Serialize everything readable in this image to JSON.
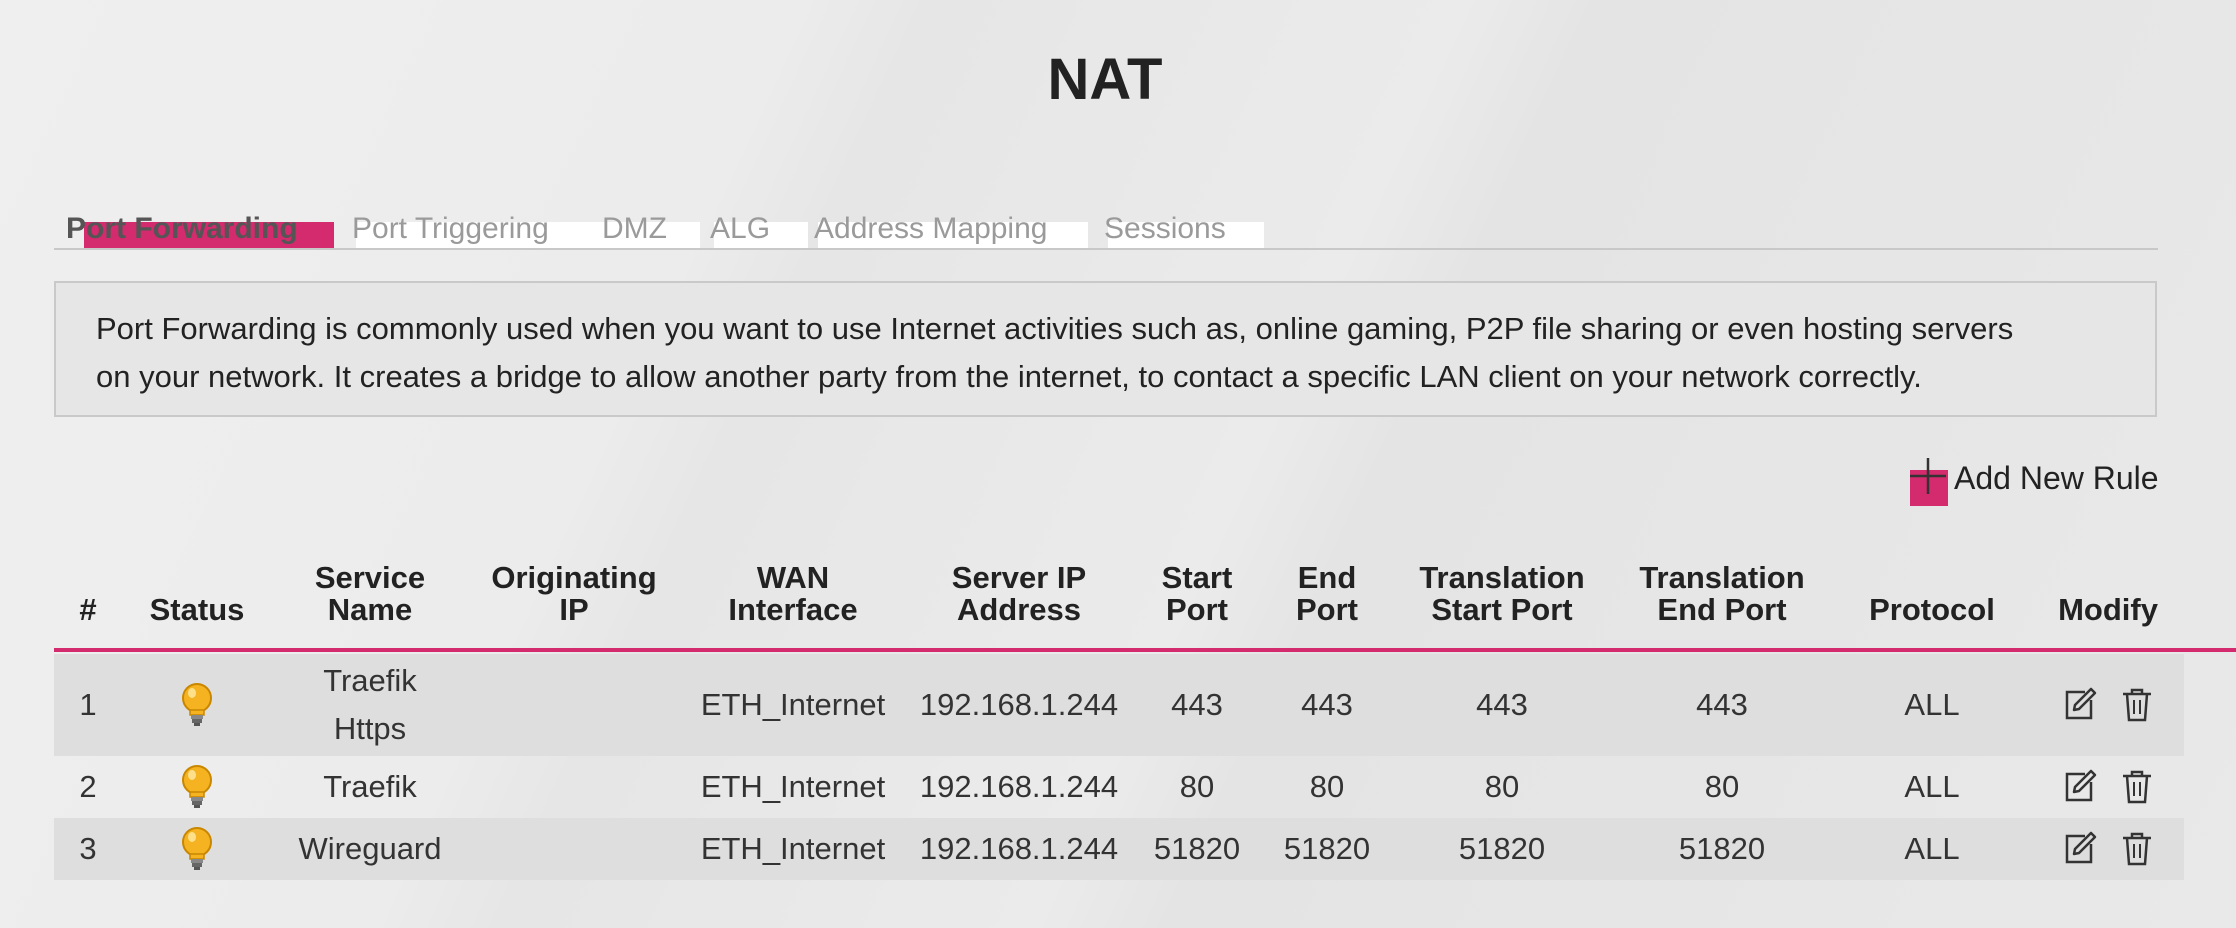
{
  "page": {
    "title": "NAT"
  },
  "tabs": [
    {
      "label": "Port Forwarding",
      "active": true
    },
    {
      "label": "Port Triggering",
      "active": false
    },
    {
      "label": "DMZ",
      "active": false
    },
    {
      "label": "ALG",
      "active": false
    },
    {
      "label": "Address Mapping",
      "active": false
    },
    {
      "label": "Sessions",
      "active": false
    }
  ],
  "description": {
    "line1": "Port Forwarding is commonly used when you want to use Internet activities such as, online gaming, P2P file sharing or even hosting servers",
    "line2": "on your network. It creates a bridge to allow another party from the internet, to contact a specific LAN client on your network correctly."
  },
  "actions": {
    "add_rule_label": "Add New Rule",
    "add_icon": "plus-icon"
  },
  "table": {
    "headers": {
      "num": "#",
      "status": "Status",
      "service_1": "Service",
      "service_2": "Name",
      "orig_1": "Originating",
      "orig_2": "IP",
      "wan_1": "WAN",
      "wan_2": "Interface",
      "server_1": "Server IP",
      "server_2": "Address",
      "start_1": "Start",
      "start_2": "Port",
      "end_1": "End",
      "end_2": "Port",
      "tstart_1": "Translation",
      "tstart_2": "Start Port",
      "tend_1": "Translation",
      "tend_2": "End Port",
      "protocol": "Protocol",
      "modify": "Modify"
    },
    "rows": [
      {
        "num": "1",
        "status_icon": "lightbulb-icon",
        "service_1": "Traefik",
        "service_2": "Https",
        "originating_ip": "",
        "wan": "ETH_Internet",
        "server_ip": "192.168.1.244",
        "start_port": "443",
        "end_port": "443",
        "trans_start": "443",
        "trans_end": "443",
        "protocol": "ALL"
      },
      {
        "num": "2",
        "status_icon": "lightbulb-icon",
        "service_1": "Traefik",
        "service_2": "",
        "originating_ip": "",
        "wan": "ETH_Internet",
        "server_ip": "192.168.1.244",
        "start_port": "80",
        "end_port": "80",
        "trans_start": "80",
        "trans_end": "80",
        "protocol": "ALL"
      },
      {
        "num": "3",
        "status_icon": "lightbulb-icon",
        "service_1": "Wireguard",
        "service_2": "",
        "originating_ip": "",
        "wan": "ETH_Internet",
        "server_ip": "192.168.1.244",
        "start_port": "51820",
        "end_port": "51820",
        "trans_start": "51820",
        "trans_end": "51820",
        "protocol": "ALL"
      }
    ]
  },
  "colors": {
    "accent": "#d42a6e",
    "bulb": "#f5b321"
  }
}
